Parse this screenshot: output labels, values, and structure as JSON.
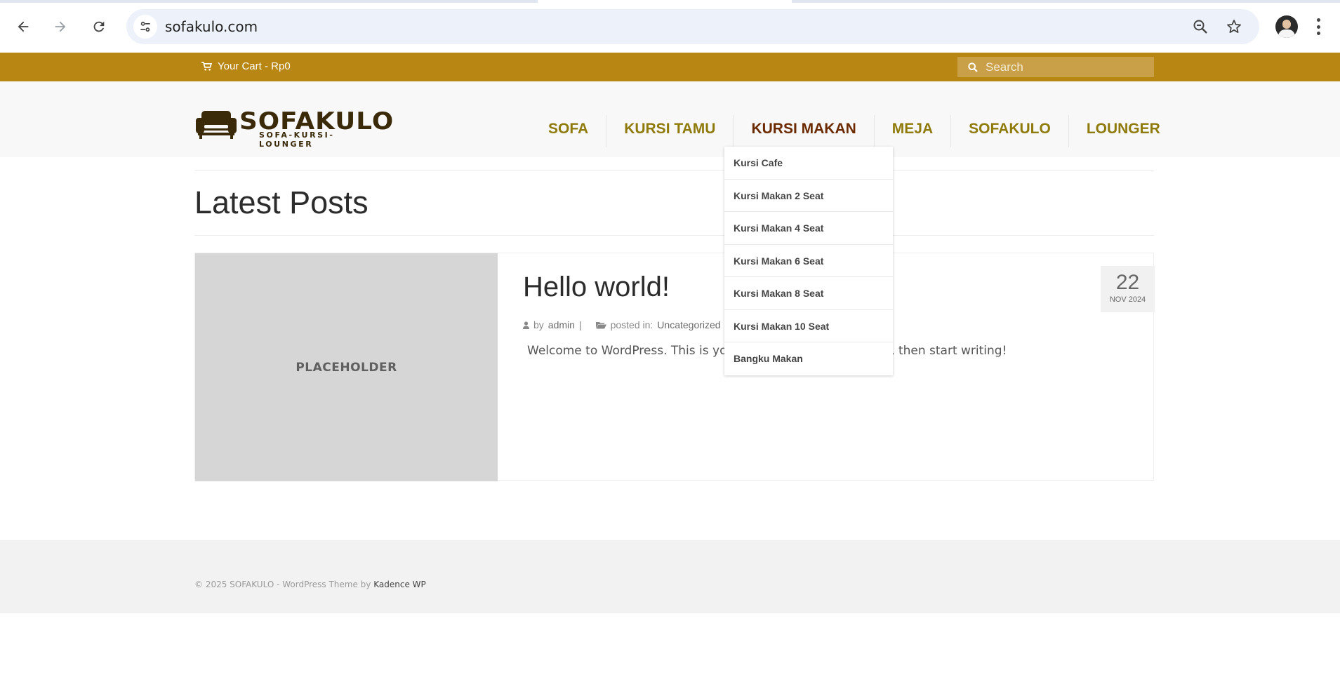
{
  "browser": {
    "url": "sofakulo.com",
    "icons": [
      "back-arrow-icon",
      "forward-arrow-icon",
      "reload-icon",
      "site-info-icon",
      "zoom-out-icon",
      "bookmark-star-icon",
      "profile-avatar",
      "more-menu-icon"
    ]
  },
  "topbar": {
    "cart_label": "Your Cart - Rp0",
    "search_placeholder": "Search",
    "bg_color": "#b88613"
  },
  "header": {
    "logo_text": "SOFAKULO",
    "logo_tagline": "SOFA-KURSI-LOUNGER",
    "nav": [
      "SOFA",
      "KURSI TAMU",
      "KURSI MAKAN",
      "MEJA",
      "SOFAKULO",
      "LOUNGER"
    ],
    "active_nav": "KURSI MAKAN",
    "nav_color": "#8f7a0c",
    "active_color": "#6b2a00"
  },
  "dropdown": {
    "items": [
      "Kursi Cafe",
      "Kursi Makan 2 Seat",
      "Kursi Makan 4 Seat",
      "Kursi Makan 6 Seat",
      "Kursi Makan 8 Seat",
      "Kursi Makan 10 Seat",
      "Bangku Makan"
    ]
  },
  "main": {
    "page_title": "Latest Posts",
    "post": {
      "image_label": "PLACEHOLDER",
      "title": "Hello world!",
      "by_label": "by",
      "author": "admin",
      "separator": "|",
      "posted_in_label": "posted in:",
      "category": "Uncategorized",
      "excerpt_start": "Welcome to WordPress. This is yo",
      "excerpt_end": "t, then start writing!",
      "date_day": "22",
      "date_month_year": "NOV 2024"
    }
  },
  "footer": {
    "credit_text": "© 2025 SOFAKULO - WordPress Theme by",
    "credit_link": "Kadence WP"
  }
}
